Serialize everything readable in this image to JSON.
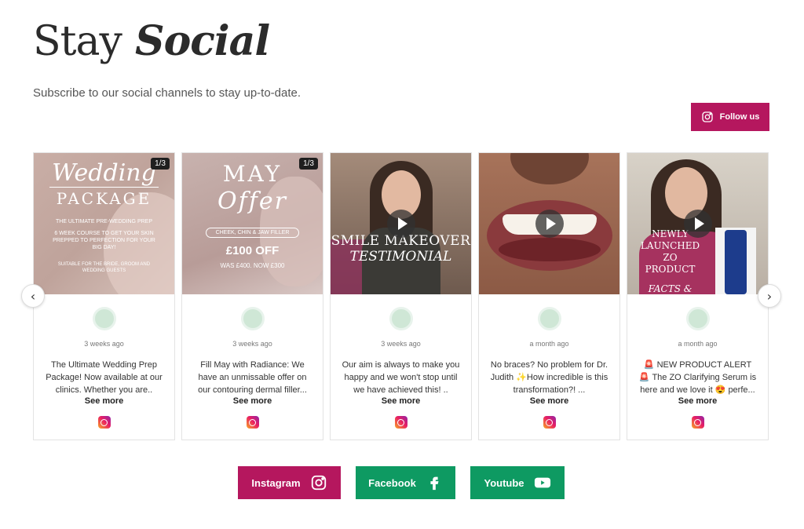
{
  "header": {
    "title_light": "Stay",
    "title_bold": "Social",
    "subtitle": "Subscribe to our social channels to stay up-to-date."
  },
  "follow": {
    "label": "Follow us",
    "color": "#b5175e"
  },
  "carousel": {
    "prev_label": "‹",
    "next_label": "›",
    "see_more": "See more",
    "posts": [
      {
        "time": "3 weeks ago",
        "caption": "The Ultimate Wedding Prep Package! Now available at our clinics. Whether you are..",
        "pager": "1/3",
        "media_lines": [
          "Wedding",
          "PACKAGE",
          "THE ULTIMATE PRE-WEDDING PREP",
          "6 WEEK COURSE TO GET YOUR SKIN PREPPED TO PERFECTION FOR YOUR BIG DAY!",
          "SUITABLE FOR THE BRIDE, GROOM AND WEDDING GUESTS"
        ]
      },
      {
        "time": "3 weeks ago",
        "caption": "Fill May with Radiance: We have an unmissable offer on our contouring dermal filler...",
        "pager": "1/3",
        "media_lines": [
          "MAY",
          "Offer",
          "CHEEK, CHIN & JAW FILLER",
          "£100 OFF",
          "WAS £400. NOW £300"
        ]
      },
      {
        "time": "3 weeks ago",
        "caption": "Our aim is always to make you happy and we won't stop until we have achieved this! ..",
        "media_lines": [
          "SMILE MAKEOVER",
          "TESTIMONIAL"
        ]
      },
      {
        "time": "a month ago",
        "caption": "No braces? No problem for Dr. Judith ✨How incredible is this transformation?! ...",
        "media_lines": []
      },
      {
        "time": "a month ago",
        "caption": "🚨 NEW PRODUCT ALERT 🚨 The ZO Clarifying Serum is here and we love it 😍 perfe...",
        "media_lines": [
          "NEWLY",
          "LAUNCHED",
          "ZO",
          "PRODUCT",
          "FACTS &"
        ]
      }
    ]
  },
  "socials": [
    {
      "label": "Instagram",
      "icon": "instagram-icon",
      "color": "#b5175e"
    },
    {
      "label": "Facebook",
      "icon": "facebook-icon",
      "color": "#0e9a62"
    },
    {
      "label": "Youtube",
      "icon": "youtube-icon",
      "color": "#0e9a62"
    }
  ]
}
